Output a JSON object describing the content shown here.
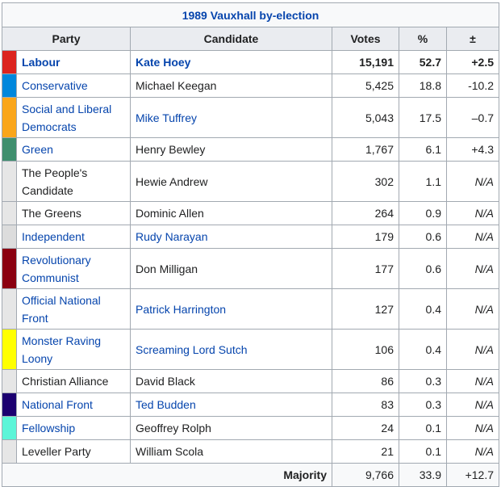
{
  "title": "1989 Vauxhall by-election",
  "headers": {
    "party": "Party",
    "candidate": "Candidate",
    "votes": "Votes",
    "pct": "%",
    "change": "±"
  },
  "rows": [
    {
      "party": "Labour",
      "candidate": "Kate Hoey",
      "votes": "15,191",
      "pct": "52.7",
      "change": "+2.5",
      "color": "#dc241f",
      "party_link": true,
      "candidate_link": true,
      "bold": true,
      "tall": false
    },
    {
      "party": "Conservative",
      "candidate": "Michael Keegan",
      "votes": "5,425",
      "pct": "18.8",
      "change": "-10.2",
      "color": "#0087dc",
      "party_link": true,
      "candidate_link": false,
      "bold": false,
      "tall": false
    },
    {
      "party": "Social and Liberal Democrats",
      "candidate": "Mike Tuffrey",
      "votes": "5,043",
      "pct": "17.5",
      "change": "–0.7",
      "color": "#faa61a",
      "party_link": true,
      "candidate_link": true,
      "bold": false,
      "tall": true
    },
    {
      "party": "Green",
      "candidate": "Henry Bewley",
      "votes": "1,767",
      "pct": "6.1",
      "change": "+4.3",
      "color": "#3f8f6e",
      "party_link": true,
      "candidate_link": false,
      "bold": false,
      "tall": false
    },
    {
      "party": "The People's Candidate",
      "candidate": "Hewie Andrew",
      "votes": "302",
      "pct": "1.1",
      "change": "N/A",
      "color": "#e6e6e6",
      "party_link": false,
      "candidate_link": false,
      "bold": false,
      "tall": true
    },
    {
      "party": "The Greens",
      "candidate": "Dominic Allen",
      "votes": "264",
      "pct": "0.9",
      "change": "N/A",
      "color": "#e6e6e6",
      "party_link": false,
      "candidate_link": false,
      "bold": false,
      "tall": false
    },
    {
      "party": "Independent",
      "candidate": "Rudy Narayan",
      "votes": "179",
      "pct": "0.6",
      "change": "N/A",
      "color": "#dcdcdc",
      "party_link": true,
      "candidate_link": true,
      "bold": false,
      "tall": false
    },
    {
      "party": "Revolutionary Communist",
      "candidate": "Don Milligan",
      "votes": "177",
      "pct": "0.6",
      "change": "N/A",
      "color": "#8b0010",
      "party_link": true,
      "candidate_link": false,
      "bold": false,
      "tall": true
    },
    {
      "party": "Official National Front",
      "candidate": "Patrick Harrington",
      "votes": "127",
      "pct": "0.4",
      "change": "N/A",
      "color": "#e6e6e6",
      "party_link": true,
      "candidate_link": true,
      "bold": false,
      "tall": true
    },
    {
      "party": "Monster Raving Loony",
      "candidate": "Screaming Lord Sutch",
      "votes": "106",
      "pct": "0.4",
      "change": "N/A",
      "color": "#ffff00",
      "party_link": true,
      "candidate_link": true,
      "bold": false,
      "tall": true
    },
    {
      "party": "Christian Alliance",
      "candidate": "David Black",
      "votes": "86",
      "pct": "0.3",
      "change": "N/A",
      "color": "#e6e6e6",
      "party_link": false,
      "candidate_link": false,
      "bold": false,
      "tall": false
    },
    {
      "party": "National Front",
      "candidate": "Ted Budden",
      "votes": "83",
      "pct": "0.3",
      "change": "N/A",
      "color": "#1b0070",
      "party_link": true,
      "candidate_link": true,
      "bold": false,
      "tall": false
    },
    {
      "party": "Fellowship",
      "candidate": "Geoffrey Rolph",
      "votes": "24",
      "pct": "0.1",
      "change": "N/A",
      "color": "#5cf5d8",
      "party_link": true,
      "candidate_link": false,
      "bold": false,
      "tall": false
    },
    {
      "party": "Leveller Party",
      "candidate": "William Scola",
      "votes": "21",
      "pct": "0.1",
      "change": "N/A",
      "color": "#e6e6e6",
      "party_link": false,
      "candidate_link": false,
      "bold": false,
      "tall": false
    }
  ],
  "majority": {
    "label": "Majority",
    "votes": "9,766",
    "pct": "33.9",
    "change": "+12.7"
  }
}
